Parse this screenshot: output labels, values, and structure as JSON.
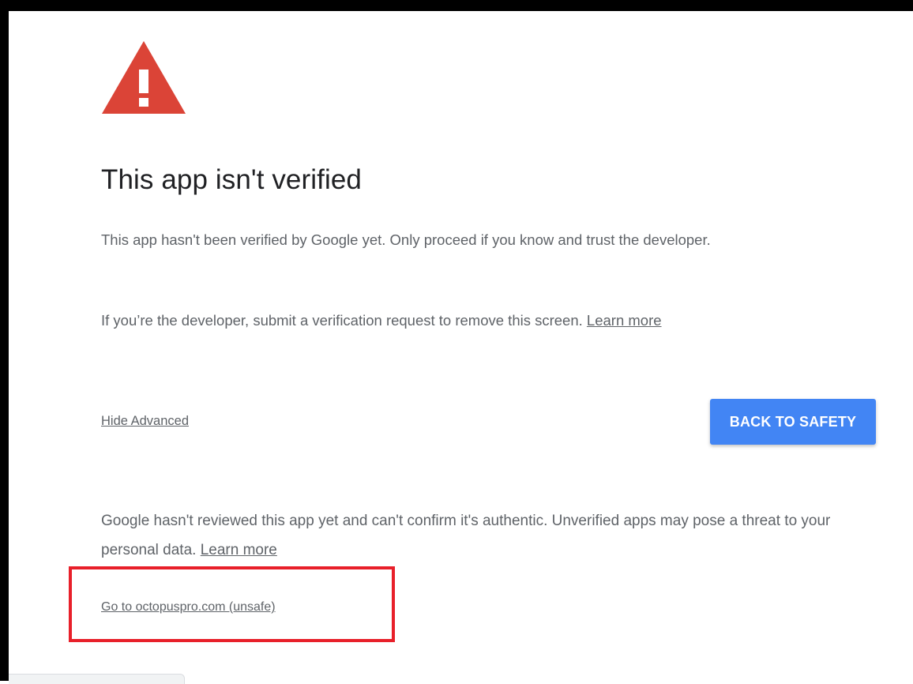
{
  "warning": {
    "icon": "warning-triangle-icon",
    "color": "#db4437"
  },
  "title": "This app isn't verified",
  "description": {
    "line1": "This app hasn't been verified by Google yet. Only proceed if you know and trust the developer.",
    "line2_text": "If you’re the developer, submit a verification request to remove this screen. ",
    "line2_link": "Learn more"
  },
  "actions": {
    "hide_advanced_label": "Hide Advanced",
    "back_to_safety_label": "BACK TO SAFETY",
    "button_color": "#4285f4"
  },
  "advanced": {
    "text": "Google hasn't reviewed this app yet and can't confirm it's authentic. Unverified apps may pose a threat to your personal data. ",
    "link": "Learn more",
    "unsafe_link": "Go to octopuspro.com (unsafe)"
  },
  "annotation": {
    "highlight_color": "#e8202a"
  }
}
